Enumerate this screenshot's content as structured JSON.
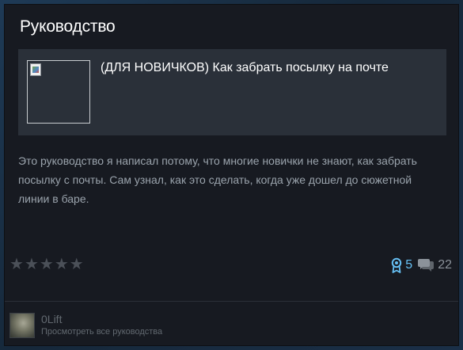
{
  "card": {
    "title": "Руководство"
  },
  "guide": {
    "title": "(ДЛЯ НОВИЧКОВ) Как забрать посылку на почте",
    "thumbnail_state": "broken-image"
  },
  "description": "Это руководство я написал потому, что многие новички не знают, как забрать посылку с почты. Сам узнал, как это сделать, когда уже дошел до сюжетной линии в баре.",
  "rating": {
    "filled_stars": 0,
    "total_stars": 5,
    "star_glyph": "★"
  },
  "stats": {
    "awards": "5",
    "comments": "22",
    "award_icon": "award-ribbon-icon",
    "comment_icon": "speech-bubbles-icon"
  },
  "author": {
    "name": "0Lift",
    "view_all_label": "Просмотреть все руководства"
  },
  "colors": {
    "background": "#1b2838",
    "card": "#171a21",
    "guide_box": "#2a3039",
    "accent": "#66c0f4",
    "muted_text": "#9aa3ac"
  }
}
